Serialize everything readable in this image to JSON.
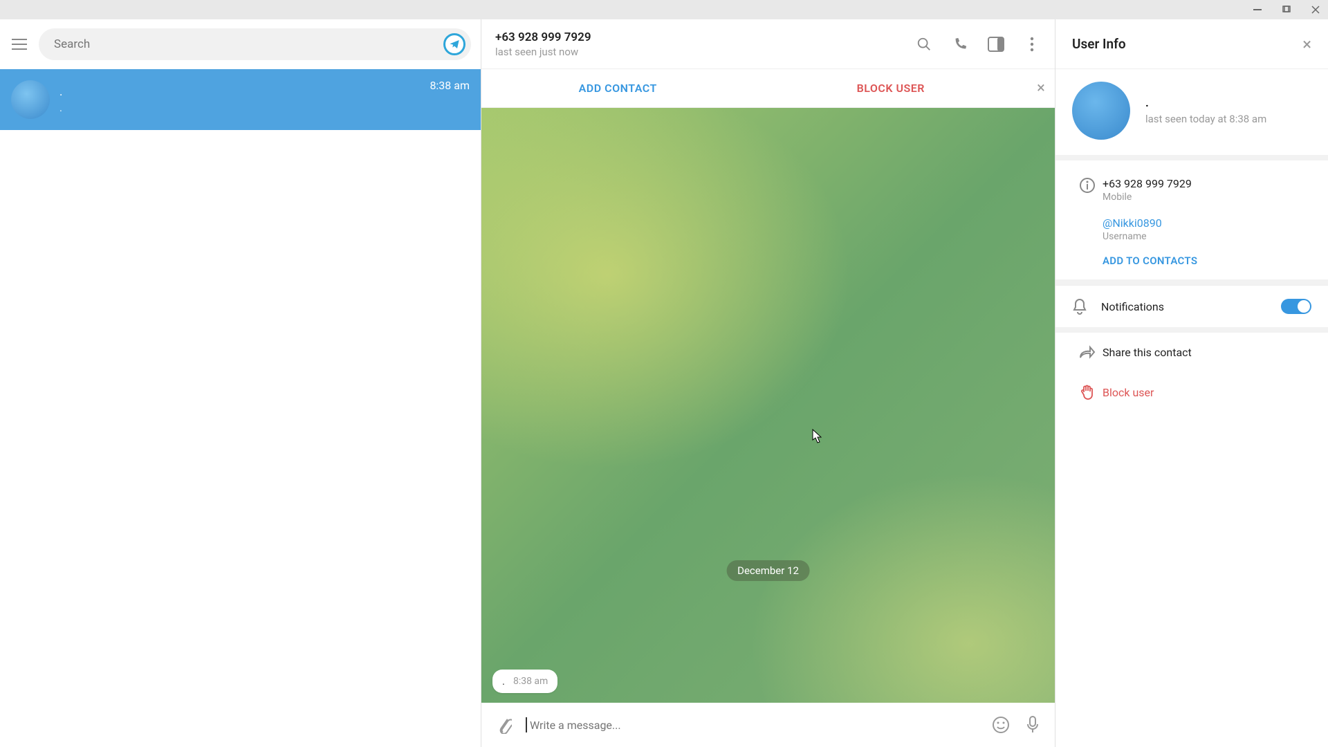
{
  "sidebar": {
    "search_placeholder": "Search",
    "chat": {
      "name": ".",
      "preview": ".",
      "time": "8:38 am"
    }
  },
  "chat_header": {
    "title": "+63 928 999 7929",
    "subtitle": "last seen just now"
  },
  "banner": {
    "add": "ADD CONTACT",
    "block": "BLOCK USER"
  },
  "chat": {
    "date_pill": "December 12",
    "msg_text": ".",
    "msg_time": "8:38 am",
    "compose_placeholder": "Write a message..."
  },
  "info": {
    "title": "User Info",
    "profile_name": ".",
    "profile_sub": "last seen today at 8:38 am",
    "phone": "+63 928 999 7929",
    "phone_label": "Mobile",
    "username": "@Nikki0890",
    "username_label": "Username",
    "add_contacts": "ADD TO CONTACTS",
    "notifications": "Notifications",
    "share": "Share this contact",
    "block": "Block user"
  }
}
